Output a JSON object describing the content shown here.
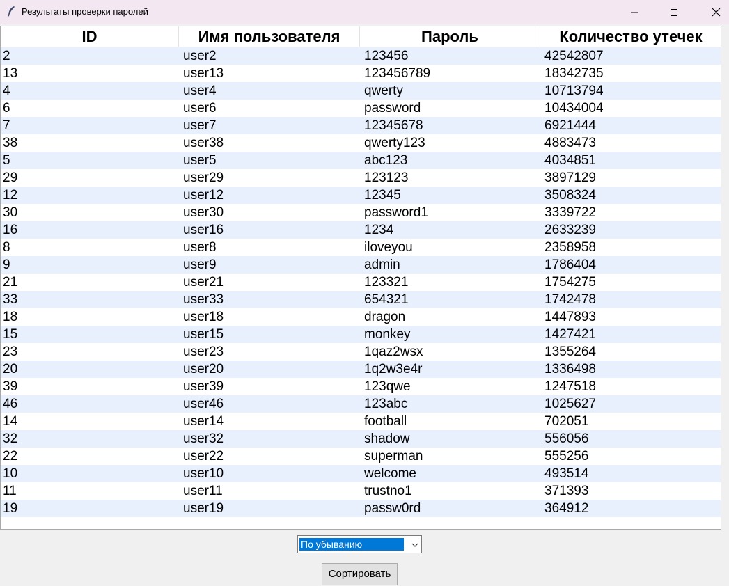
{
  "window": {
    "title": "Результаты проверки паролей",
    "icon": "feather-icon",
    "controls": [
      "minimize-icon",
      "maximize-icon",
      "close-icon"
    ]
  },
  "table": {
    "columns": [
      "ID",
      "Имя пользователя",
      "Пароль",
      "Количество утечек"
    ],
    "rows": [
      [
        "2",
        "user2",
        "123456",
        "42542807"
      ],
      [
        "13",
        "user13",
        "123456789",
        "18342735"
      ],
      [
        "4",
        "user4",
        "qwerty",
        "10713794"
      ],
      [
        "6",
        "user6",
        "password",
        "10434004"
      ],
      [
        "7",
        "user7",
        "12345678",
        "6921444"
      ],
      [
        "38",
        "user38",
        "qwerty123",
        "4883473"
      ],
      [
        "5",
        "user5",
        "abc123",
        "4034851"
      ],
      [
        "29",
        "user29",
        "123123",
        "3897129"
      ],
      [
        "12",
        "user12",
        "12345",
        "3508324"
      ],
      [
        "30",
        "user30",
        "password1",
        "3339722"
      ],
      [
        "16",
        "user16",
        "1234",
        "2633239"
      ],
      [
        "8",
        "user8",
        "iloveyou",
        "2358958"
      ],
      [
        "9",
        "user9",
        "admin",
        "1786404"
      ],
      [
        "21",
        "user21",
        "123321",
        "1754275"
      ],
      [
        "33",
        "user33",
        "654321",
        "1742478"
      ],
      [
        "18",
        "user18",
        "dragon",
        "1447893"
      ],
      [
        "15",
        "user15",
        "monkey",
        "1427421"
      ],
      [
        "23",
        "user23",
        "1qaz2wsx",
        "1355264"
      ],
      [
        "20",
        "user20",
        "1q2w3e4r",
        "1336498"
      ],
      [
        "39",
        "user39",
        "123qwe",
        "1247518"
      ],
      [
        "46",
        "user46",
        "123abc",
        "1025627"
      ],
      [
        "14",
        "user14",
        "football",
        "702051"
      ],
      [
        "32",
        "user32",
        "shadow",
        "556056"
      ],
      [
        "22",
        "user22",
        "superman",
        "555256"
      ],
      [
        "10",
        "user10",
        "welcome",
        "493514"
      ],
      [
        "11",
        "user11",
        "trustno1",
        "371393"
      ],
      [
        "19",
        "user19",
        "passw0rd",
        "364912"
      ]
    ]
  },
  "controls": {
    "sort_order_selected": "По убыванию",
    "sort_button_label": "Сортировать"
  },
  "colors": {
    "titlebar": "#f3e7f1",
    "row_stripe": "#e8f0fe",
    "selection": "#0078d7"
  }
}
